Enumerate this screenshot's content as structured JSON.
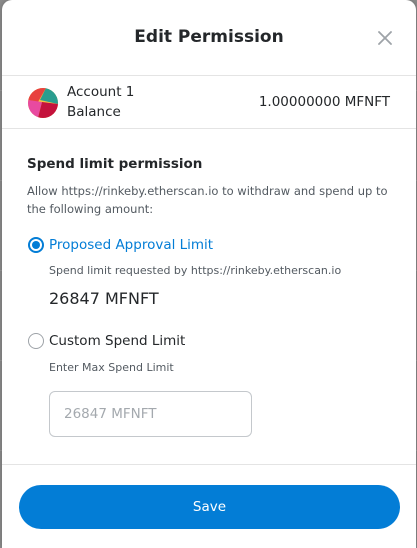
{
  "dialog": {
    "title": "Edit Permission"
  },
  "account": {
    "name": "Account 1",
    "balance_label": "Balance",
    "balance_value": "1.00000000 MFNFT"
  },
  "permission": {
    "title": "Spend limit permission",
    "description": "Allow https://rinkeby.etherscan.io to withdraw and spend up to the following amount:",
    "proposed": {
      "label": "Proposed Approval Limit",
      "sublabel": "Spend limit requested by https://rinkeby.etherscan.io",
      "amount": "26847 MFNFT",
      "selected": true
    },
    "custom": {
      "label": "Custom Spend Limit",
      "sublabel": "Enter Max Spend Limit",
      "placeholder": "26847 MFNFT",
      "value": "",
      "selected": false
    }
  },
  "footer": {
    "save_label": "Save"
  },
  "colors": {
    "accent": "#037dd6",
    "text": "#24272a",
    "muted": "#535a61"
  },
  "icons": {
    "close": "close-icon",
    "avatar": "account-avatar"
  }
}
